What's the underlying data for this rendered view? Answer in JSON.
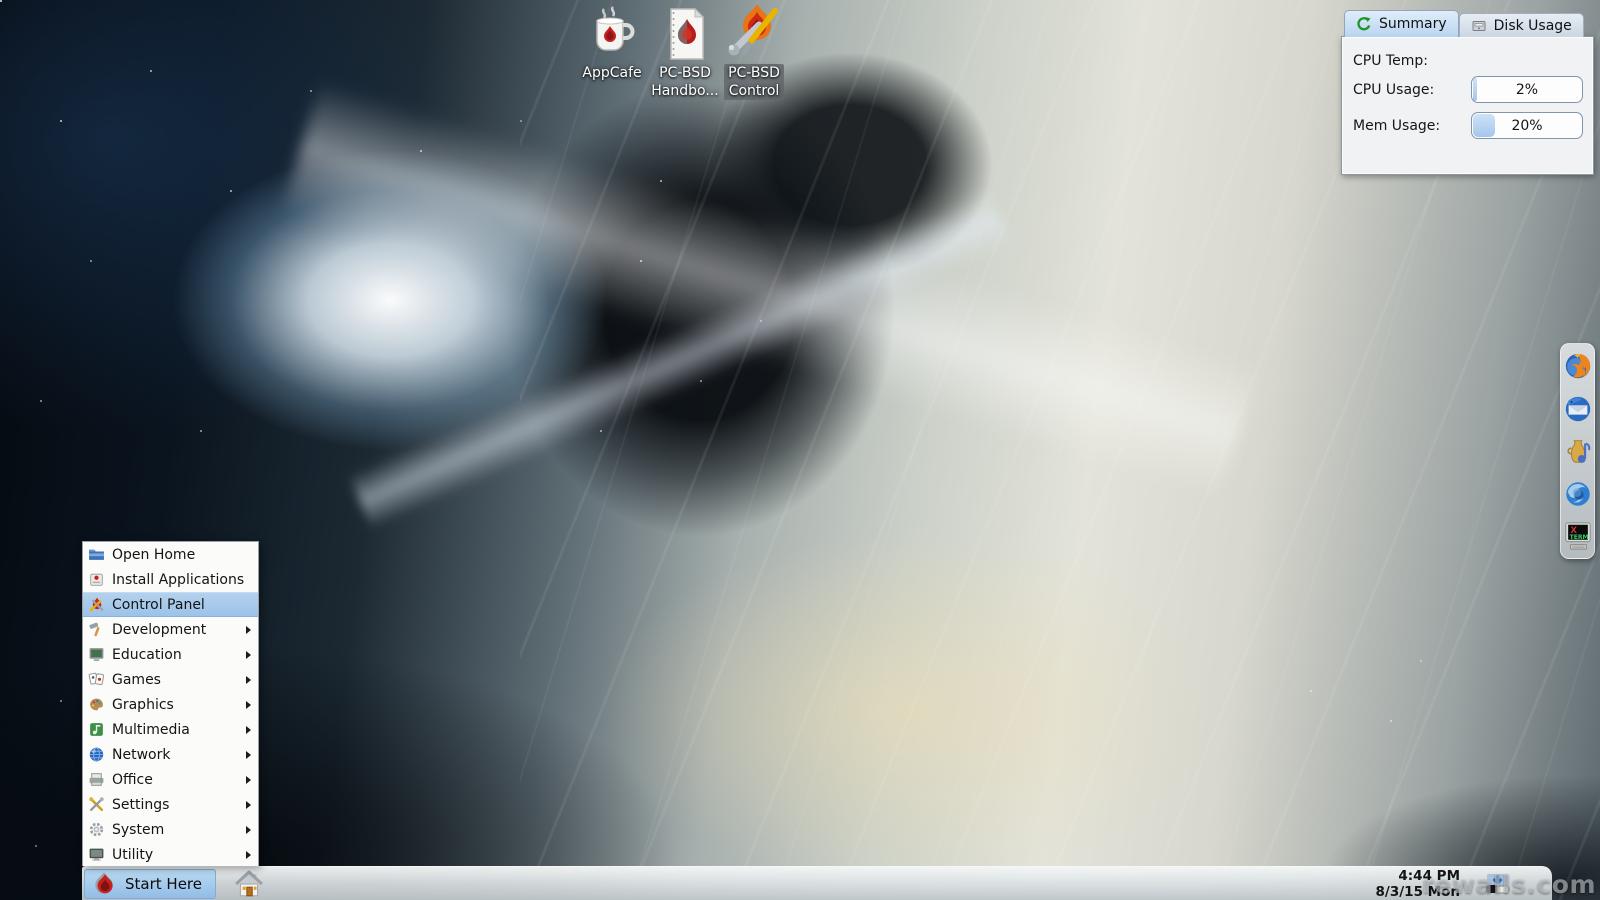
{
  "colors": {
    "selection_blue": "#9cc2e8",
    "progress_fill": "#a4c6ec",
    "flame_red": "#c42020",
    "taskbar_gray": "#d8dee0"
  },
  "desktop": {
    "icons": [
      {
        "name": "appcafe",
        "icon": "appcafe-mug-icon",
        "lines": [
          "AppCafe"
        ]
      },
      {
        "name": "pcbsd-handbook",
        "icon": "handbook-document-icon",
        "lines": [
          "PC-BSD",
          "Handbo..."
        ]
      },
      {
        "name": "pcbsd-control",
        "icon": "control-tools-icon",
        "lines": [
          "PC-BSD",
          "Control"
        ]
      }
    ],
    "watermark": "rewalls.com"
  },
  "monitor_widget": {
    "tabs": [
      {
        "label": "Summary",
        "icon": "refresh-icon",
        "active": true
      },
      {
        "label": "Disk Usage",
        "icon": "disk-icon",
        "active": false
      }
    ],
    "rows": [
      {
        "label": "CPU Temp:",
        "value": "",
        "percent": null
      },
      {
        "label": "CPU Usage:",
        "value": "2%",
        "percent": 2
      },
      {
        "label": "Mem Usage:",
        "value": "20%",
        "percent": 20
      }
    ]
  },
  "start_menu": {
    "items": [
      {
        "label": "Open Home",
        "icon": "home-folder-icon",
        "submenu": false,
        "highlighted": false
      },
      {
        "label": "Install Applications",
        "icon": "package-icon",
        "submenu": false,
        "highlighted": false
      },
      {
        "label": "Control Panel",
        "icon": "control-panel-icon",
        "submenu": false,
        "highlighted": true
      },
      {
        "label": "Development",
        "icon": "hammer-icon",
        "submenu": true,
        "highlighted": false
      },
      {
        "label": "Education",
        "icon": "blackboard-icon",
        "submenu": true,
        "highlighted": false
      },
      {
        "label": "Games",
        "icon": "cards-icon",
        "submenu": true,
        "highlighted": false
      },
      {
        "label": "Graphics",
        "icon": "palette-icon",
        "submenu": true,
        "highlighted": false
      },
      {
        "label": "Multimedia",
        "icon": "media-icon",
        "submenu": true,
        "highlighted": false
      },
      {
        "label": "Network",
        "icon": "globe-icon",
        "submenu": true,
        "highlighted": false
      },
      {
        "label": "Office",
        "icon": "printer-icon",
        "submenu": true,
        "highlighted": false
      },
      {
        "label": "Settings",
        "icon": "crossed-tools-icon",
        "submenu": true,
        "highlighted": false
      },
      {
        "label": "System",
        "icon": "gear-icon",
        "submenu": true,
        "highlighted": false
      },
      {
        "label": "Utility",
        "icon": "monitor-icon",
        "submenu": true,
        "highlighted": false
      }
    ]
  },
  "taskbar": {
    "start_button": {
      "label": "Start Here",
      "icon": "pcbsd-flame-icon"
    },
    "home_button": {
      "icon": "house-icon"
    },
    "tray": [
      {
        "icon": "updater-icon"
      }
    ],
    "clock": {
      "time": "4:44 PM",
      "date": "8/3/15 Mon"
    }
  },
  "dock": {
    "items": [
      {
        "icon": "firefox-icon"
      },
      {
        "icon": "thunderbird-icon"
      },
      {
        "icon": "juk-music-icon"
      },
      {
        "icon": "konqueror-globe-icon"
      },
      {
        "icon": "xterm-icon"
      }
    ]
  }
}
